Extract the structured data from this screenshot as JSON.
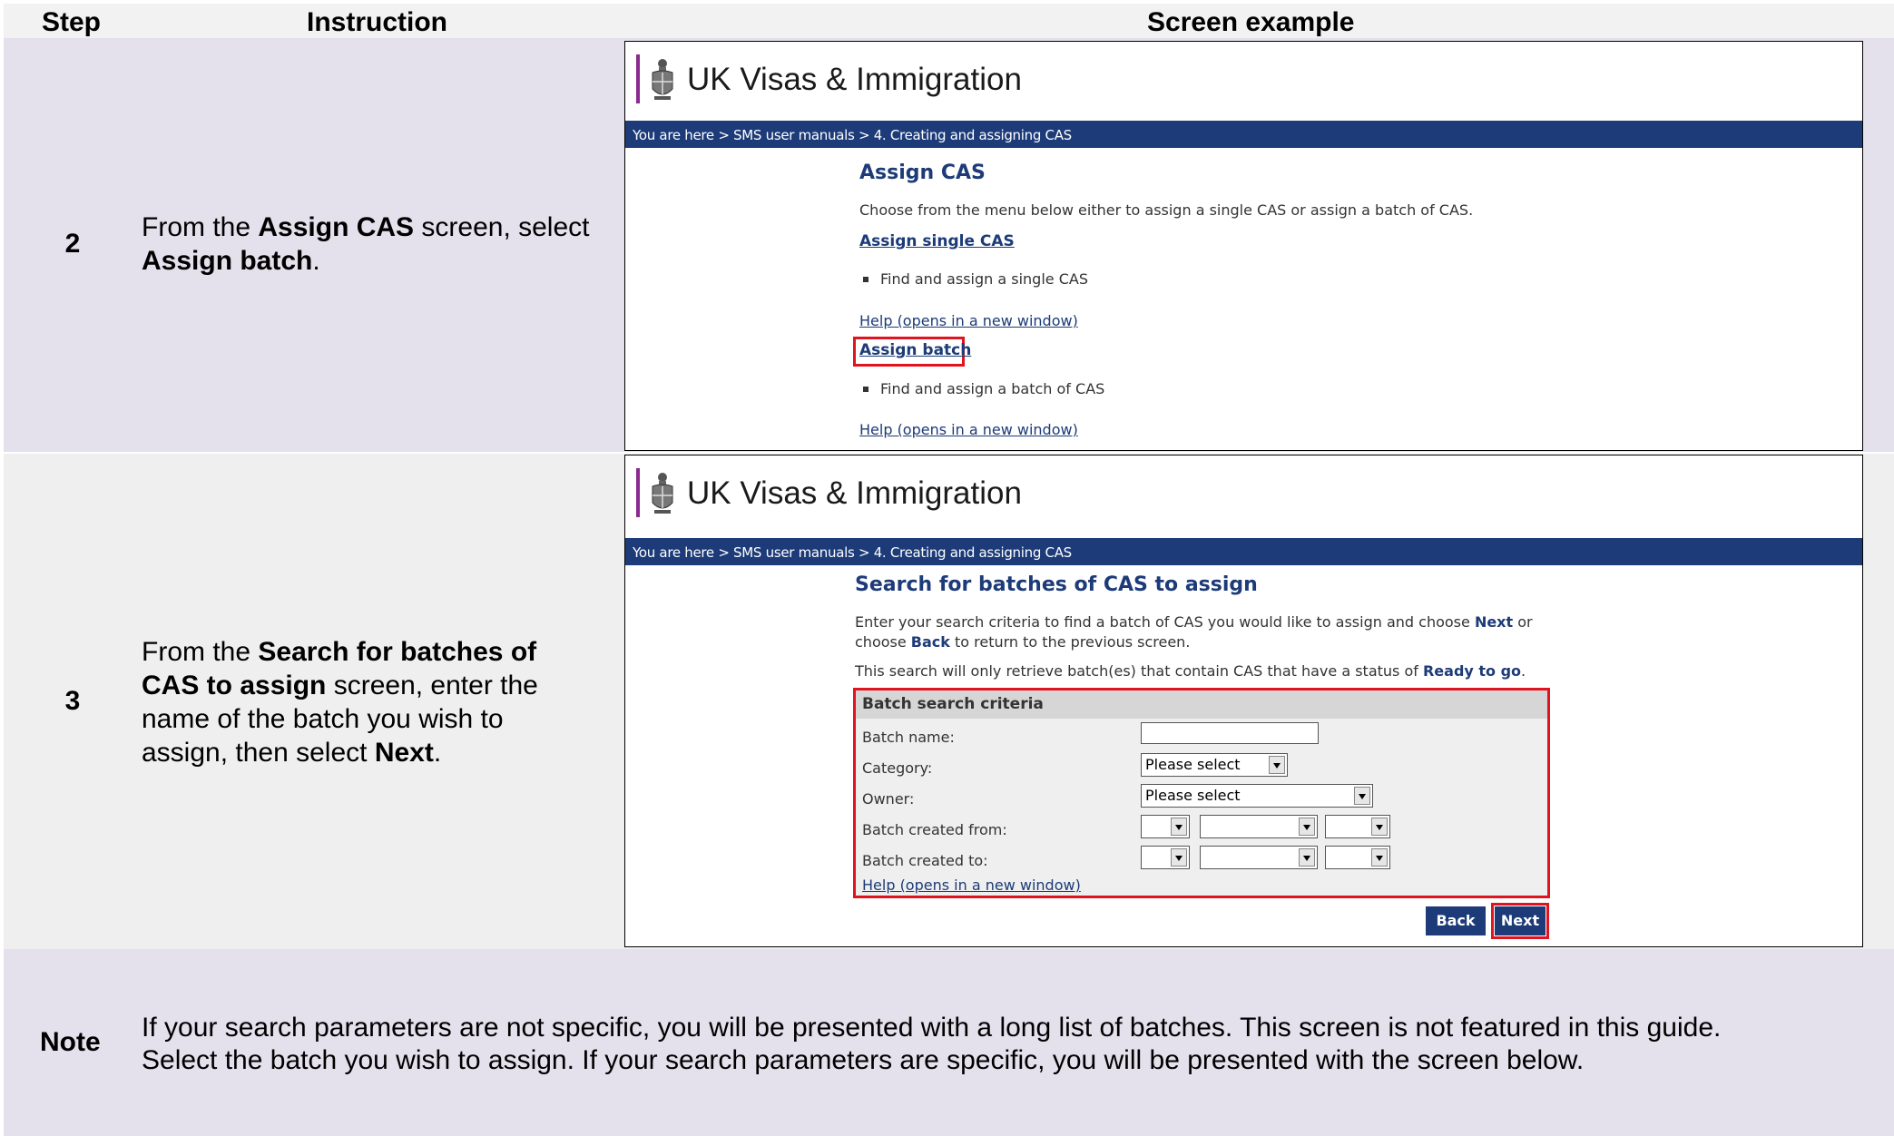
{
  "header": {
    "step_col": "Step",
    "instruction_col": "Instruction",
    "screen_col": "Screen example"
  },
  "rows": [
    {
      "step": "2",
      "instruction": [
        "From the ",
        "Assign CAS",
        " screen, select ",
        "Assign batch",
        "."
      ],
      "screen": {
        "logo_text": "UK Visas & Immigration",
        "breadcrumb": "You are here > SMS user manuals >  4. Creating and assigning CAS",
        "title": "Assign CAS",
        "intro": "Choose from the menu below either to assign a single CAS or assign a batch of CAS.",
        "single_link": "Assign single CAS",
        "single_desc": "Find and assign a single CAS",
        "help_link": "Help (opens in a new window)",
        "batch_link": "Assign batch",
        "batch_desc": "Find and assign a batch of CAS",
        "help_link_2": "Help (opens in a new window)"
      }
    },
    {
      "step": "3",
      "instruction": [
        "From the ",
        "Search for batches of CAS to assign",
        " screen, enter the name of the batch you wish to assign, then select ",
        "Next",
        "."
      ],
      "screen": {
        "logo_text": "UK Visas & Immigration",
        "breadcrumb": "You are here > SMS user manuals >  4. Creating and assigning CAS",
        "title": "Search for batches of CAS to assign",
        "intro_1a": "Enter your search criteria to find a batch of CAS you would like to assign and choose ",
        "intro_1b": "Next",
        "intro_1c": " or",
        "intro_2a": "choose ",
        "intro_2b": "Back",
        "intro_2c": " to return to the previous screen.",
        "intro_3a": "This search will only retrieve batch(es) that contain CAS that have a status of ",
        "intro_3b": "Ready to go",
        "intro_3c": ".",
        "criteria_heading": "Batch search criteria",
        "batch_name_label": "Batch name:",
        "batch_name_value": "",
        "category_label": "Category:",
        "category_value": "Please select",
        "owner_label": "Owner:",
        "owner_value": "Please select",
        "from_label": "Batch created from:",
        "to_label": "Batch created to:",
        "help_link": "Help (opens in a new window)",
        "back_button": "Back",
        "next_button": "Next"
      }
    }
  ],
  "note": {
    "label": "Note",
    "line1": "If your search parameters are not specific, you will be presented with a long list of batches. This screen is not featured in this guide.",
    "line2": "Select the batch you wish to assign. If your search parameters are specific, you will be presented with the screen below."
  },
  "colors": {
    "nav_blue": "#1c3b78",
    "highlight_red": "#e0141e",
    "logo_purple": "#8a2a8f"
  }
}
